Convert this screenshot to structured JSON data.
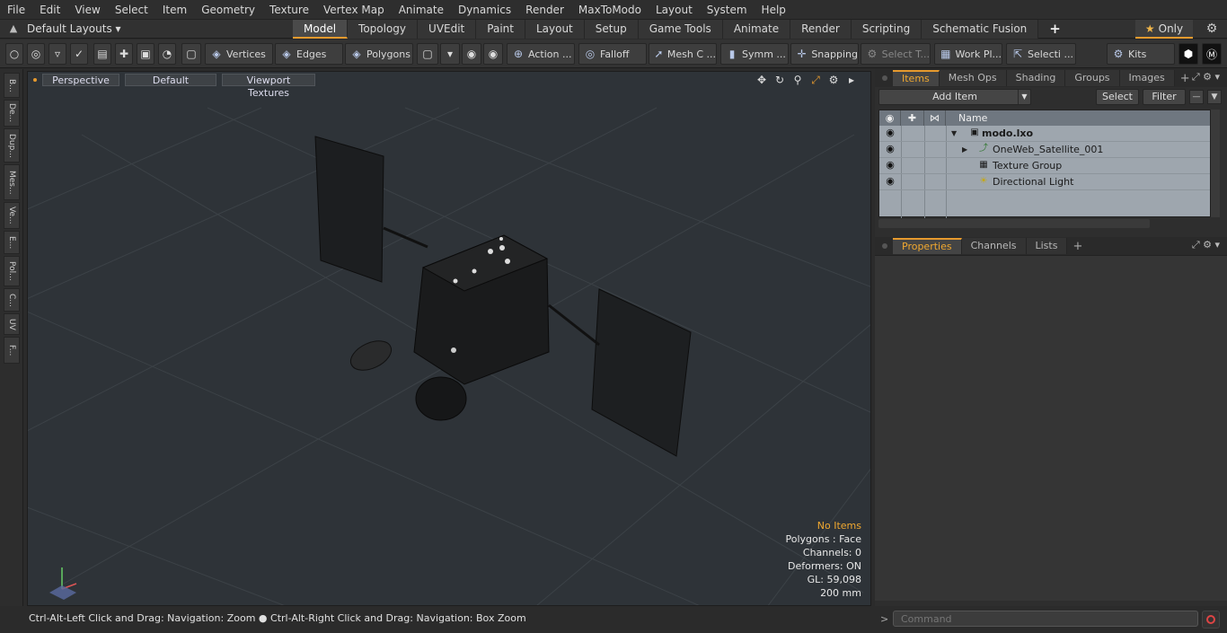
{
  "menu": [
    "File",
    "Edit",
    "View",
    "Select",
    "Item",
    "Geometry",
    "Texture",
    "Vertex Map",
    "Animate",
    "Dynamics",
    "Render",
    "MaxToModo",
    "Layout",
    "System",
    "Help"
  ],
  "layout_bar": {
    "layout_dropdown": "Default Layouts ▾",
    "tabs": [
      "Model",
      "Topology",
      "UVEdit",
      "Paint",
      "Layout",
      "Setup",
      "Game Tools",
      "Animate",
      "Render",
      "Scripting",
      "Schematic Fusion"
    ],
    "active_tab": "Model",
    "only_label": "Only"
  },
  "toolbar": {
    "vertices": "Vertices",
    "edges": "Edges",
    "polygons": "Polygons",
    "action": "Action ...",
    "falloff": "Falloff",
    "mesh": "Mesh C ...",
    "symm": "Symm ...",
    "snapping": "Snapping",
    "select_t": "Select T...",
    "workpl": "Work Pl...",
    "selecti": "Selecti ...",
    "kits": "Kits"
  },
  "left_strip": [
    "B...",
    "De...",
    "Dup...",
    "Mes...",
    "Ve...",
    "E...",
    "Pol...",
    "C...",
    "UV",
    "F..."
  ],
  "viewport": {
    "view_mode": "Perspective",
    "shading": "Default",
    "textures": "Viewport Textures",
    "stats": {
      "items": "No Items",
      "polygons": "Polygons : Face",
      "channels": "Channels: 0",
      "deformers": "Deformers: ON",
      "gl": "GL: 59,098",
      "scale": "200 mm"
    }
  },
  "items_panel": {
    "tabs": [
      "Items",
      "Mesh Ops",
      "Shading",
      "Groups",
      "Images"
    ],
    "active_tab": "Items",
    "add_item": "Add Item",
    "select": "Select",
    "filter": "Filter",
    "column_name": "Name",
    "tree": [
      {
        "label": "modo.lxo",
        "bold": true
      },
      {
        "label": "OneWeb_Satellite_001"
      },
      {
        "label": "Texture Group"
      },
      {
        "label": "Directional Light"
      }
    ]
  },
  "properties_panel": {
    "tabs": [
      "Properties",
      "Channels",
      "Lists"
    ],
    "active_tab": "Properties"
  },
  "status": {
    "hint_left": "Ctrl-Alt-Left Click and Drag: Navigation: Zoom",
    "hint_right": "Ctrl-Alt-Right Click and Drag: Navigation: Box Zoom",
    "command_placeholder": "Command"
  },
  "colors": {
    "accent": "#e69a2e",
    "viewport_bg": "#2e3338",
    "tree_bg": "#9ea6ae"
  }
}
